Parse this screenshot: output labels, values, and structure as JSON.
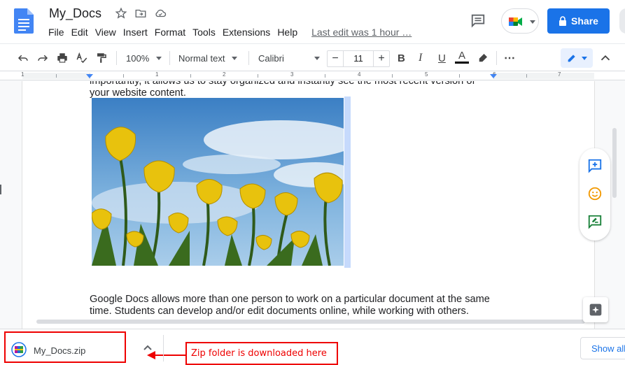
{
  "app": {
    "doc_title": "My_Docs",
    "share_label": "Share"
  },
  "menu": {
    "items": [
      "File",
      "Edit",
      "View",
      "Insert",
      "Format",
      "Tools",
      "Extensions",
      "Help"
    ],
    "last_edit": "Last edit was 1 hour …"
  },
  "toolbar": {
    "zoom": "100%",
    "style": "Normal text",
    "font": "Calibri",
    "font_size": "11",
    "minus": "−",
    "plus": "+",
    "bold": "B",
    "italic": "I",
    "underline": "U",
    "text_color_letter": "A",
    "more": "⋯"
  },
  "ruler": {
    "numbers": [
      "1",
      "1",
      "2",
      "3",
      "4",
      "5",
      "6",
      "7"
    ]
  },
  "document": {
    "para1_line1": "importantly, it allows us to stay organized and instantly see the most recent version of",
    "para1_line2": "your website content.",
    "para2_line1": "Google Docs allows more than one person to work on a particular document at the same",
    "para2_line2": "time. Students can develop and/or edit documents online, while working with others."
  },
  "downloads": {
    "file_name": "My_Docs.zip",
    "show_all": "Show all",
    "annotation": "Zip folder is downloaded here"
  },
  "colors": {
    "accent": "#1a73e8",
    "annotation_red": "#ee0000"
  }
}
